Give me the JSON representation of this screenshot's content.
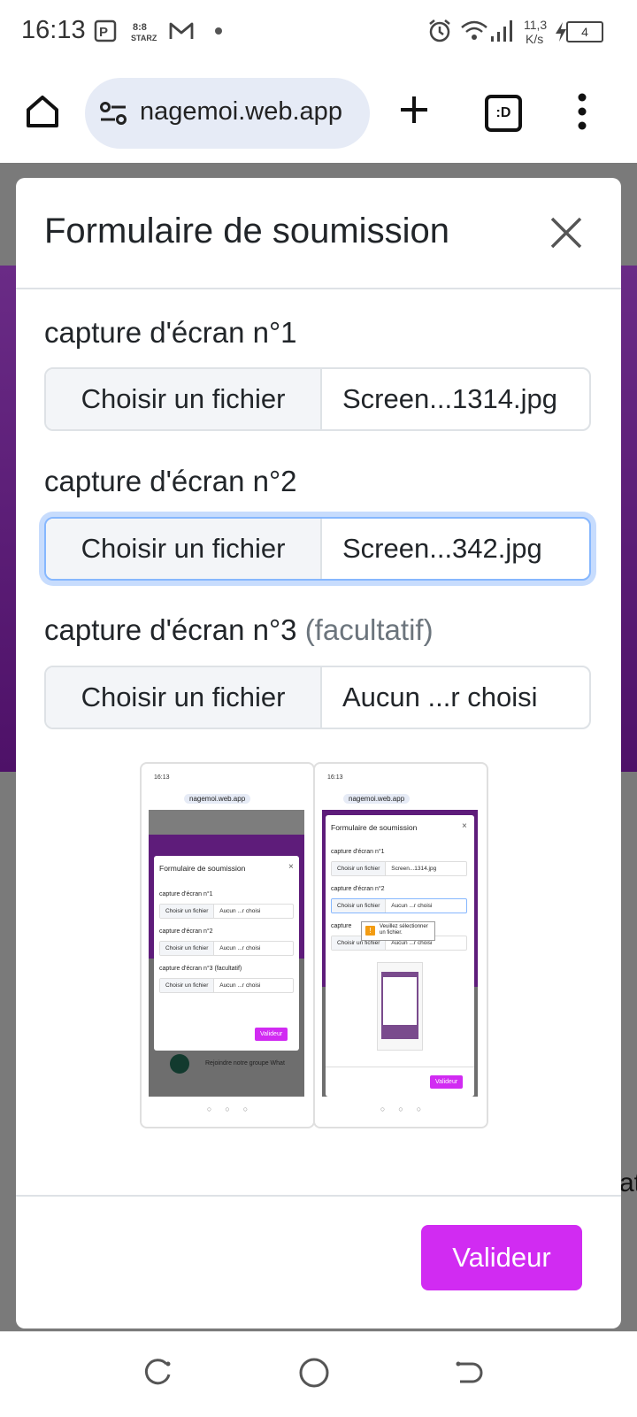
{
  "status_bar": {
    "time": "16:13",
    "network_speed_value": "11,3",
    "network_speed_unit": "K/s",
    "battery": "4"
  },
  "browser": {
    "url": "nagemoi.web.app",
    "tab_switcher_label": ":D"
  },
  "page": {
    "side_text": "at"
  },
  "modal": {
    "title": "Formulaire de soumission",
    "fields": [
      {
        "label": "capture d'écran n°1",
        "optional_label": "",
        "button": "Choisir un fichier",
        "file": "Screen...1314.jpg"
      },
      {
        "label": "capture d'écran n°2",
        "optional_label": "",
        "button": "Choisir un fichier",
        "file": "Screen...342.jpg"
      },
      {
        "label": "capture d'écran n°3",
        "optional_label": "(facultatif)",
        "button": "Choisir un fichier",
        "file": "Aucun ...r choisi"
      }
    ],
    "submit_label": "Valideur"
  },
  "preview1": {
    "time": "16:13",
    "url": "nagemoi.web.app",
    "title": "Formulaire de soumission",
    "labels": [
      "capture d'écran n°1",
      "capture d'écran n°2",
      "capture d'écran n°3 (facultatif)"
    ],
    "button": "Choisir un fichier",
    "file": "Aucun ...r choisi",
    "submit": "Valideur",
    "whatsapp": "Rejoindre notre groupe What"
  },
  "preview2": {
    "time": "16:13",
    "url": "nagemoi.web.app",
    "title": "Formulaire de soumission",
    "labels": [
      "capture d'écran n°1",
      "capture d'écran n°2",
      "capture"
    ],
    "button": "Choisir un fichier",
    "files": [
      "Screen...1314.jpg",
      "Aucun ...r choisi",
      "Aucun ...r choisi"
    ],
    "tooltip": "Veuillez sélectionner un fichier.",
    "submit": "Valideur"
  },
  "colors": {
    "accent": "#d12bf2",
    "page_purple": "#5e1c7a",
    "focus_ring": "#86b7fe"
  },
  "icons": [
    "home-icon",
    "site-settings-icon",
    "new-tab-icon",
    "tab-switcher-icon",
    "more-menu-icon",
    "close-icon",
    "recent-apps-icon",
    "home-nav-icon",
    "back-icon",
    "alarm-icon",
    "wifi-icon",
    "signal-icon",
    "battery-icon"
  ]
}
